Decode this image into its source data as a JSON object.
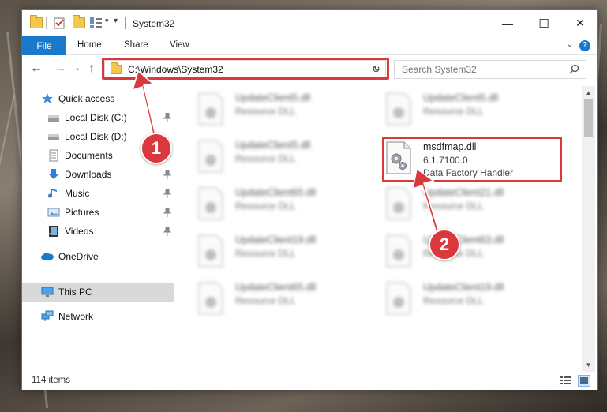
{
  "window": {
    "title": "System32",
    "controls": {
      "minimize": "—",
      "maximize": "☐",
      "close": "✕"
    }
  },
  "ribbon": {
    "file_tab": "File",
    "tabs": [
      "Home",
      "Share",
      "View"
    ]
  },
  "navigation": {
    "address": "C:\\Windows\\System32",
    "search_placeholder": "Search System32"
  },
  "sidebar": {
    "items": [
      {
        "label": "Quick access",
        "icon": "star-icon"
      },
      {
        "label": "Local Disk (C:)",
        "icon": "drive-icon",
        "pinned": true
      },
      {
        "label": "Local Disk (D:)",
        "icon": "drive-icon",
        "pinned": true
      },
      {
        "label": "Documents",
        "icon": "documents-icon",
        "pinned": true
      },
      {
        "label": "Downloads",
        "icon": "download-icon",
        "pinned": true
      },
      {
        "label": "Music",
        "icon": "music-icon",
        "pinned": true
      },
      {
        "label": "Pictures",
        "icon": "pictures-icon",
        "pinned": true
      },
      {
        "label": "Videos",
        "icon": "videos-icon",
        "pinned": true
      },
      {
        "label": "OneDrive",
        "icon": "cloud-icon"
      },
      {
        "label": "This PC",
        "icon": "computer-icon",
        "selected": true
      },
      {
        "label": "Network",
        "icon": "network-icon"
      }
    ]
  },
  "files": {
    "left_column": [
      {
        "name": "UpdateClient5.dll",
        "type": "Resource DLL"
      },
      {
        "name": "UpdateClient5.dll",
        "type": "Resource DLL"
      },
      {
        "name": "UpdateClient65.dll",
        "type": "Resource DLL"
      },
      {
        "name": "UpdateClient19.dll",
        "type": "Resource DLL"
      },
      {
        "name": "UpdateClient65.dll",
        "type": "Resource DLL"
      }
    ],
    "right_column": [
      {
        "name": "UpdateClient5.dll",
        "type": "Resource DLL"
      },
      {
        "name": "UpdateClient21.dll",
        "type": "Resource DLL"
      },
      {
        "name": "UpdateClient63.dll",
        "type": "Resource DLL"
      },
      {
        "name": "UpdateClient19.dll",
        "type": "Resource DLL"
      }
    ],
    "highlighted": {
      "name": "msdfmap.dll",
      "version": "6.1.7100.0",
      "description": "Data Factory Handler"
    }
  },
  "status": {
    "item_count": "114 items"
  },
  "annotations": {
    "step1": "1",
    "step2": "2",
    "color": "#d9383d"
  }
}
